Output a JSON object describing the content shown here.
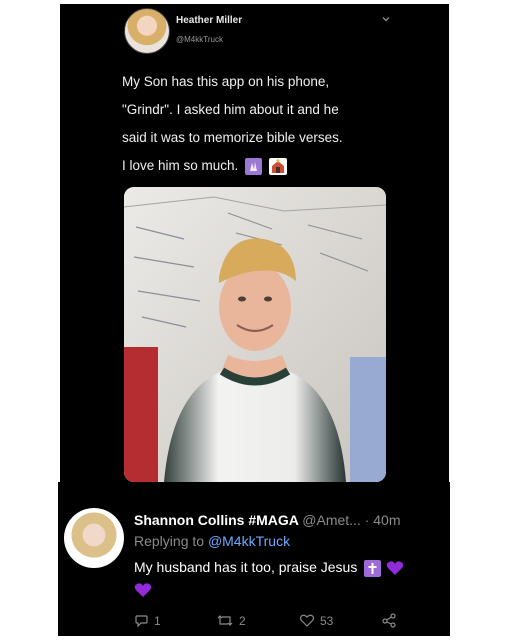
{
  "tweet": {
    "author_name": "Heather Miller",
    "handle": "@M4kkTruck",
    "lines": [
      "My Son has this app on his phone,",
      "\"Grindr\". I asked him about it and he",
      "said it was to memorize bible verses.",
      "I love him so much."
    ],
    "icons": [
      "chevron-down-icon",
      "praying-emoji",
      "church-emoji"
    ]
  },
  "reply": {
    "author_name": "Shannon Collins #MAGA",
    "meta": "@Amet... · 40m",
    "replying_prefix": "Replying to",
    "replying_handle": "@M4kkTruck",
    "text": "My husband has it too, praise Jesus",
    "actions": {
      "reply_count": "1",
      "retweet_count": "2",
      "like_count": "53"
    },
    "icons": [
      "cross-emoji",
      "purple-heart-emoji",
      "reply-icon",
      "retweet-icon",
      "like-icon",
      "share-icon"
    ]
  },
  "colors": {
    "tweet_background": "#000000",
    "link": "#6ea8ff",
    "muted": "#8b8b8b",
    "purple_heart": "#8f2bd8"
  }
}
